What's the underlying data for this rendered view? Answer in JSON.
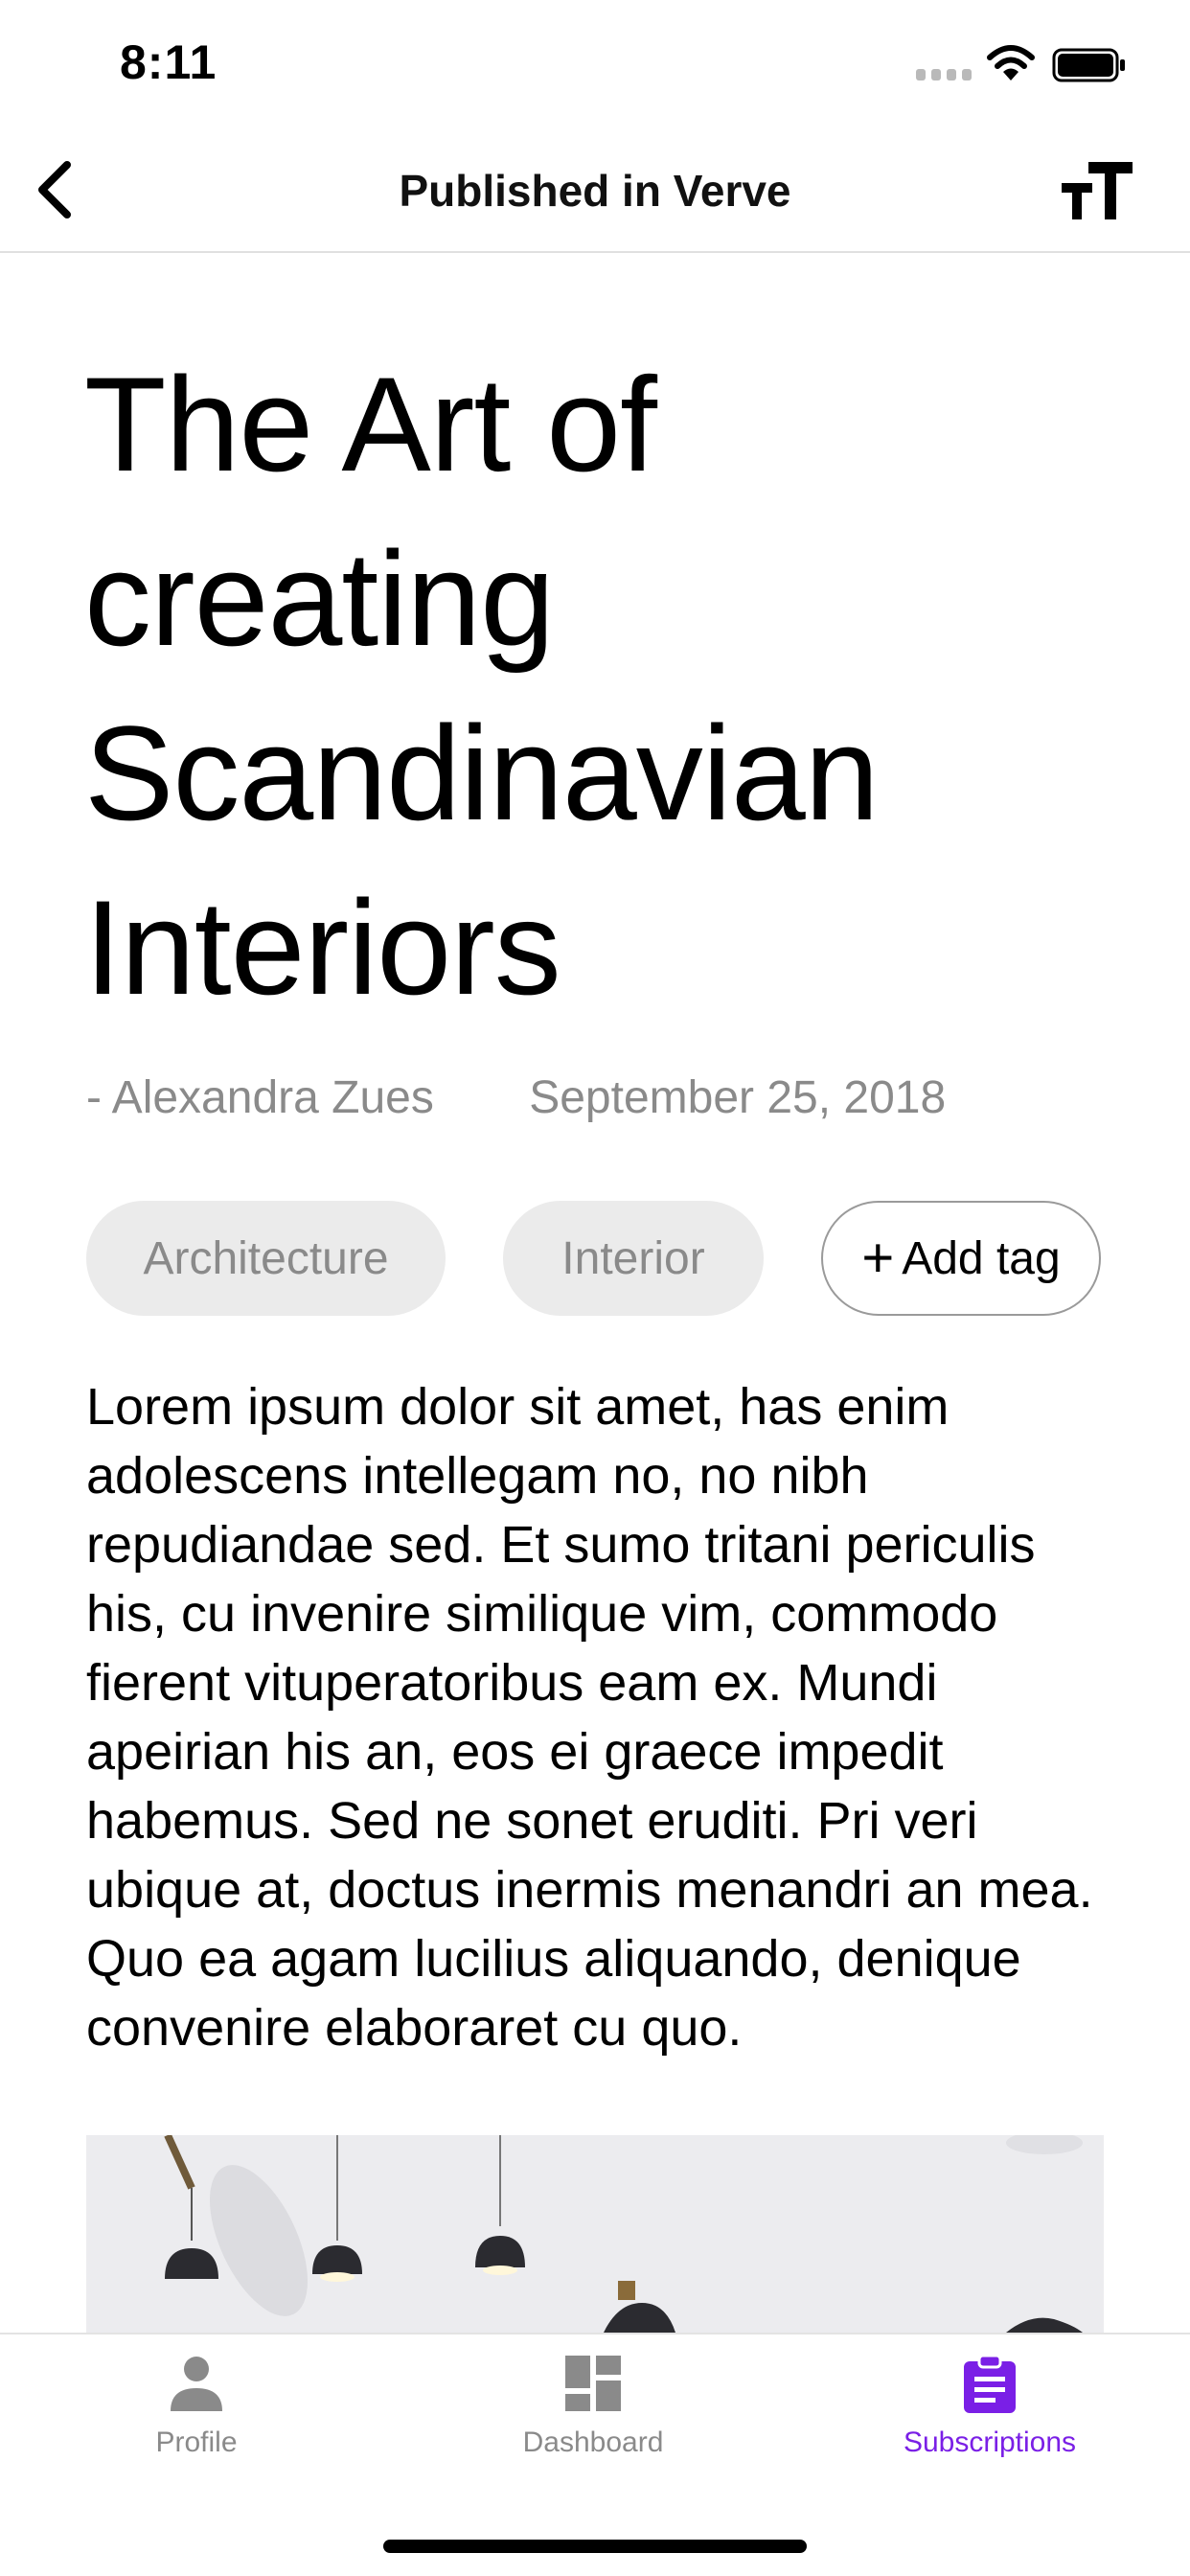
{
  "status_bar": {
    "time": "8:11"
  },
  "nav": {
    "title": "Published in Verve"
  },
  "article": {
    "title_lines": [
      "The Art of",
      "creating",
      "Scandinavian",
      "Interiors"
    ],
    "author": "- Alexandra Zues",
    "date": "September 25, 2018",
    "tags": [
      "Architecture",
      "Interior"
    ],
    "add_tag_label": "Add tag",
    "body": "Lorem ipsum dolor sit amet, has enim adolescens intellegam no, no nibh repudiandae sed. Et sumo tritani periculis his, cu invenire similique vim, commodo fierent vituperatoribus eam ex. Mundi apeirian his an, eos ei graece impedit habemus. Sed ne sonet eruditi. Pri veri ubique at, doctus inermis menandri an mea. Quo ea agam lucilius aliquando, denique convenire elaboraret cu quo."
  },
  "tab_bar": {
    "items": [
      {
        "label": "Profile",
        "icon": "person-icon"
      },
      {
        "label": "Dashboard",
        "icon": "dashboard-icon"
      },
      {
        "label": "Subscriptions",
        "icon": "clipboard-icon",
        "active": true
      }
    ],
    "accent_color": "#7a1fe6",
    "inactive_color": "#8a8a8a"
  }
}
